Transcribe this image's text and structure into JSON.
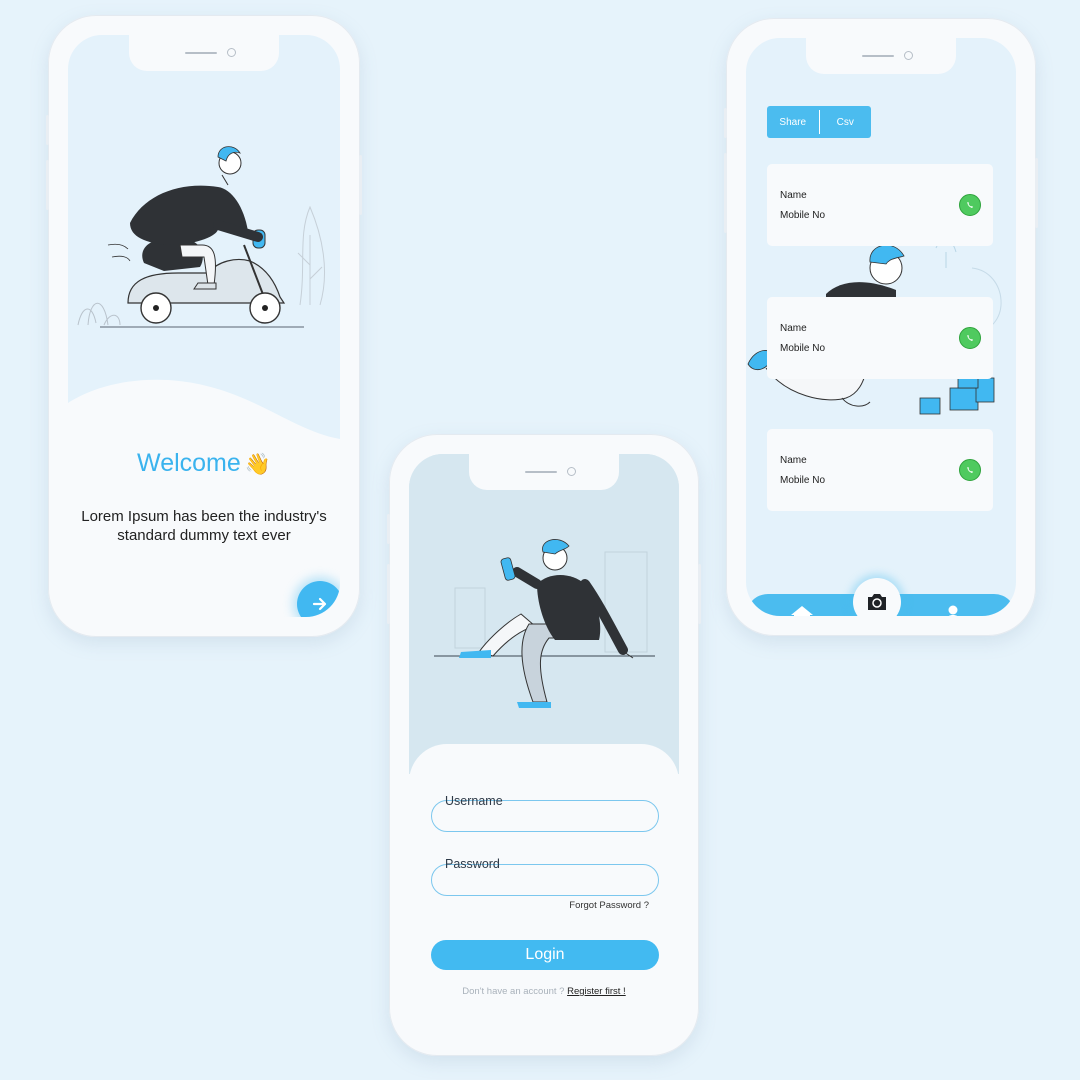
{
  "welcome_screen": {
    "title": "Welcome",
    "wave_emoji": "👋",
    "subtitle": "Lorem Ipsum has been the industry's standard dummy text ever",
    "next_icon": "arrow-right-icon"
  },
  "login_screen": {
    "username_label": "Username",
    "password_label": "Password",
    "forgot_password": "Forgot Password ?",
    "login_button": "Login",
    "no_account_text": "Don't have an account ?",
    "register_link": "Register first !"
  },
  "contacts_screen": {
    "segmented": {
      "share": "Share",
      "csv": "Csv"
    },
    "contacts": [
      {
        "name_label": "Name",
        "mobile_label": "Mobile No"
      },
      {
        "name_label": "Name",
        "mobile_label": "Mobile No"
      },
      {
        "name_label": "Name",
        "mobile_label": "Mobile No"
      }
    ],
    "nav": {
      "home_icon": "home-icon",
      "camera_icon": "camera-icon",
      "profile_icon": "user-icon"
    }
  },
  "colors": {
    "background": "#e6f3fb",
    "accent": "#42baf1",
    "card": "#f8fafc",
    "whatsapp": "#4fca5f"
  }
}
